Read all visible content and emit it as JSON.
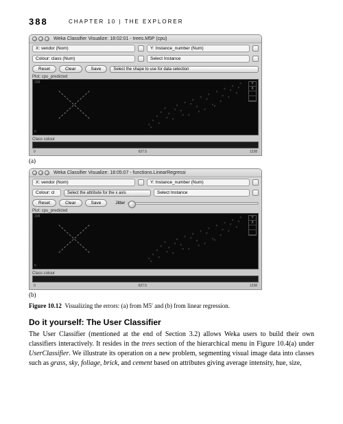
{
  "page_number": "388",
  "chapter_head": "CHAPTER 10 | THE EXPLORER",
  "window_a": {
    "title": "Weka Classifier Visualize: 18:02:01 - trees.M5P (cpu)",
    "x_axis": "X: vendor (Nom)",
    "y_axis": "Y: Instance_number (Num)",
    "colour": "Colour: class (Num)",
    "select": "Select Instance",
    "reset": "Reset",
    "clear": "Clear",
    "save": "Save",
    "shape_hint": "Select the shape to use for data selection",
    "plot_label": "Plot: cpu_predicted",
    "class_colour": "Class colour",
    "plot_ymax": "208",
    "plot_ymin": "0",
    "axis_left": "0",
    "axis_mid": "627.5",
    "axis_right": "1238"
  },
  "window_b": {
    "title": "Weka Classifier Visualize: 18:05:07 - functions.LinearRegressi",
    "x_axis": "X: vendor (Nom)",
    "y_axis": "Y: Instance_number (Num)",
    "colour_hint": "Select the attribute for the x axis",
    "colour": "Colour: cl",
    "select": "Select Instance",
    "reset": "Reset",
    "clear": "Clear",
    "save": "Save",
    "jitter": "Jitter",
    "plot_label": "Plot: cpu_predicted",
    "class_colour": "Class colour",
    "plot_ymax": "208",
    "plot_ymin": "0",
    "axis_left": "0",
    "axis_mid": "627.5",
    "axis_right": "1238"
  },
  "sublabel_a": "(a)",
  "sublabel_b": "(b)",
  "caption_bold": "Figure 10.12",
  "caption_text": "Visualizing the errors: (a) from M5′ and (b) from linear regression.",
  "section_head": "Do it yourself: The User Classifier",
  "body_text": {
    "p1a": "The User Classifier (mentioned at the end of Section 3.2) allows Weka users to build their own classifiers interactively. It resides in the ",
    "trees": "trees",
    "p1b": " section of the hierarchical menu in Figure 10.4(a) under ",
    "uc": "UserClassifier",
    "p1c": ". We illustrate its operation on a new problem, segmenting visual image data into classes such as ",
    "grass": "grass",
    "c1": ", ",
    "sky": "sky",
    "c2": ", ",
    "foliage": "foliage",
    "c3": ", ",
    "brick": "brick",
    "c4": ", and ",
    "cement": "cement",
    "p1d": " based on attributes giving average intensity, hue, size,"
  }
}
